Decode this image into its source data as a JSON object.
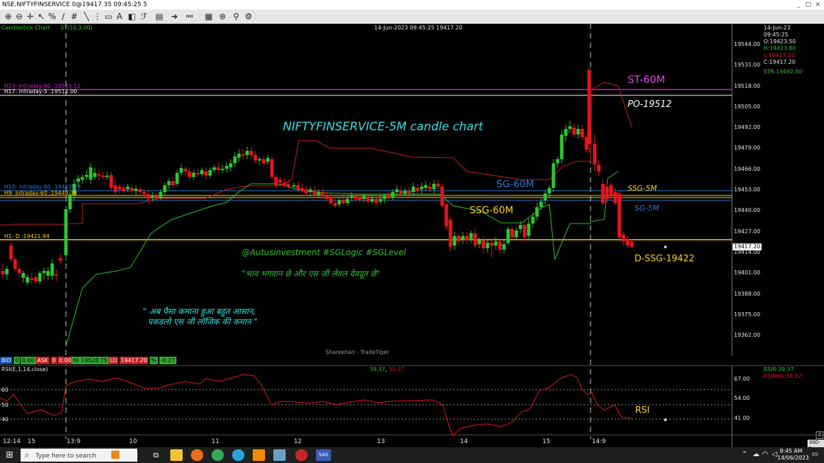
{
  "window": {
    "title": "NSE.NIFTYFINSERVICE 0@19417.35 09:45:25 5",
    "controls": [
      "_",
      "□",
      "×"
    ]
  },
  "toolbar": {
    "icons": [
      "zoom-in-icon",
      "zoom-out-icon",
      "crosshair-icon",
      "cursor-icon",
      "percent-icon",
      "draw-line-icon",
      "hash-icon",
      "trendline-icon",
      "fib-icon",
      "box-icon",
      "text-icon",
      "fibonacci-icon",
      "grid-icon",
      "arrow-icon",
      "link-icon",
      "sheet-icon",
      "compass-icon",
      "indicator-icon",
      "settings-icon"
    ]
  },
  "chart": {
    "top_left_label": "Candlestick Chart",
    "indicator_label": "ST(10,3.00)",
    "center_header": "14-Jun-2023  09:45:25  19417.20",
    "watermark": "Sharekhan - TradeTiger",
    "price_axis": [
      "19544.00",
      "19531.00",
      "19518.00",
      "19505.00",
      "19492.00",
      "19479.00",
      "19466.00",
      "19453.00",
      "19440.00",
      "19427.00",
      "19414.00",
      "19401.00",
      "19388.00",
      "19375.00",
      "19362.00"
    ],
    "current_price_tag": "19417.20",
    "info_panel": {
      "date": "14-Jun-23",
      "time": "09:45:25",
      "open": "O:19423.50",
      "high": "H:19423.80",
      "low": "L:19417.20",
      "close": "C:19417.20",
      "str": "STR:19492.50"
    },
    "level_labels": {
      "h13": "H13- Intraday-60 :19515.12",
      "h17": "H17- Intraday-5 :19512.00",
      "h10": "H10- Intraday-60 :19452.29",
      "h_overlap": "H9- Intraday-60 :19449.38",
      "h1": "H1- D :19421.94"
    },
    "annotations": {
      "title": "NIFTYFINSERVICE-5M candle chart",
      "st60": "ST-60M",
      "po": "PO-19512",
      "sg60": "SG-60M",
      "ssg5": "SSG-5M",
      "ssg60": "SSG-60M",
      "sg5": "SG-5M",
      "dssg": "D-SSG-19422",
      "handles": "@Autusinvestment  #SGLogic  #SGLevel",
      "quote1": "\"भाव भगवान छे और एस जी लेवल देवदूत छे\"",
      "quote2_line1": "\" अब पैसा कमाना हुआ बहुत आसान,",
      "quote2_line2": "पकडलो एस जी लॉजिक की कमान \"",
      "rsi": "RSI"
    },
    "bid_strip": {
      "bid_label": "BID",
      "bid_qty": "0",
      "bid_val": "0.00",
      "ask_label": "ASK",
      "ask_qty": "0",
      "ask_val": "0.00",
      "hi_label": "HI",
      "hi_val": "19528.75",
      "lo_label": "LO",
      "lo_val": "19417.20",
      "pct_label": "%",
      "pct_val": "-0.27"
    },
    "rsi_panel": {
      "label": "RSI(E,1,14,close)",
      "value_a": "39.37",
      "value_sep": ",",
      "value_b": "39.37",
      "rsir": "RSIR:39.37",
      "rsiavg": "RSIAVG:39.37",
      "axis": [
        "67.00",
        "54.00",
        "41.00"
      ],
      "levels": [
        "60",
        "50",
        "40"
      ]
    },
    "x_axis": [
      "12:14",
      "15",
      "13:9",
      "10",
      "11",
      "12",
      "13",
      "14",
      "15",
      "14:9"
    ],
    "corner_label": "30D-5",
    "colors": {
      "up": "#2fc42f",
      "down": "#e8141b",
      "h13": "#d020d0",
      "h17": "#ffffff",
      "h10": "#2a7bd6",
      "yellow": "#ffd21f",
      "supertrend_red": "#c81e1e",
      "supertrend_green": "#2fc42f"
    }
  },
  "taskbar": {
    "search_placeholder": "Type here to search",
    "time": "9:45 AM",
    "date": "14/06/2023",
    "sas_label": "SAS"
  }
}
